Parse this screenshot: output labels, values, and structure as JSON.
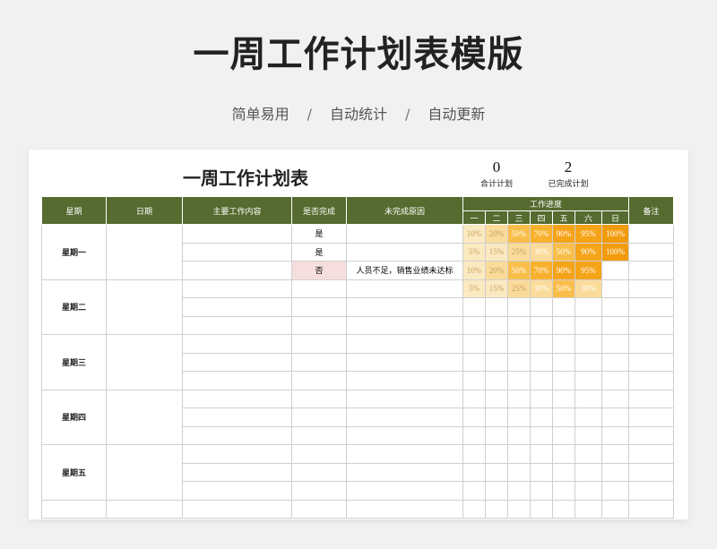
{
  "header": {
    "title": "一周工作计划表模版",
    "subtitle": [
      "简单易用",
      "自动统计",
      "自动更新"
    ],
    "separator": "/"
  },
  "sheet": {
    "title": "一周工作计划表",
    "stats": [
      {
        "value": "0",
        "label": "合计计划"
      },
      {
        "value": "2",
        "label": "已完成计划"
      }
    ],
    "columns": {
      "weekday": "星期",
      "date": "日期",
      "content": "主要工作内容",
      "done": "是否完成",
      "reason": "未完成原因",
      "progress": "工作进度",
      "days": [
        "一",
        "二",
        "三",
        "四",
        "五",
        "六",
        "日"
      ],
      "note": "备注"
    },
    "weekdays": [
      "星期一",
      "星期二",
      "星期三",
      "星期四",
      "星期五"
    ],
    "rows": [
      {
        "done": "是",
        "reason": "",
        "progress": [
          "10%",
          "20%",
          "50%",
          "70%",
          "90%",
          "95%",
          "100%"
        ]
      },
      {
        "done": "是",
        "reason": "",
        "progress": [
          "5%",
          "15%",
          "25%",
          "30%",
          "50%",
          "90%",
          "100%"
        ]
      },
      {
        "done": "否",
        "reason": "人员不足，销售业绩未达标",
        "progress": [
          "10%",
          "20%",
          "50%",
          "70%",
          "90%",
          "95%",
          ""
        ]
      },
      {
        "done": "",
        "reason": "",
        "progress": [
          "5%",
          "15%",
          "25%",
          "30%",
          "50%",
          "30%",
          ""
        ]
      }
    ],
    "colors": {
      "header_bg": "#556b2f",
      "progress_scale": [
        "#fbe9c2",
        "#fbdb9a",
        "#fac96a",
        "#f9be4a",
        "#f8b12c",
        "#f5a317",
        "#f29b0c"
      ],
      "no_bg": "#f6dede"
    }
  }
}
